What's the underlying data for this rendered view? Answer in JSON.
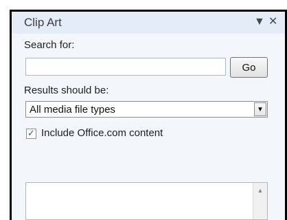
{
  "pane": {
    "title": "Clip Art",
    "menu_icon": "dropdown-triangle-icon",
    "close_icon": "close-icon"
  },
  "search": {
    "label": "Search for:",
    "value": "",
    "placeholder": "",
    "go_label": "Go"
  },
  "results": {
    "label": "Results should be:",
    "selected_type": "All media file types"
  },
  "office_content": {
    "label": "Include Office.com content",
    "checked": true
  },
  "results_list": {
    "scroll_up_icon": "scroll-up-icon"
  }
}
